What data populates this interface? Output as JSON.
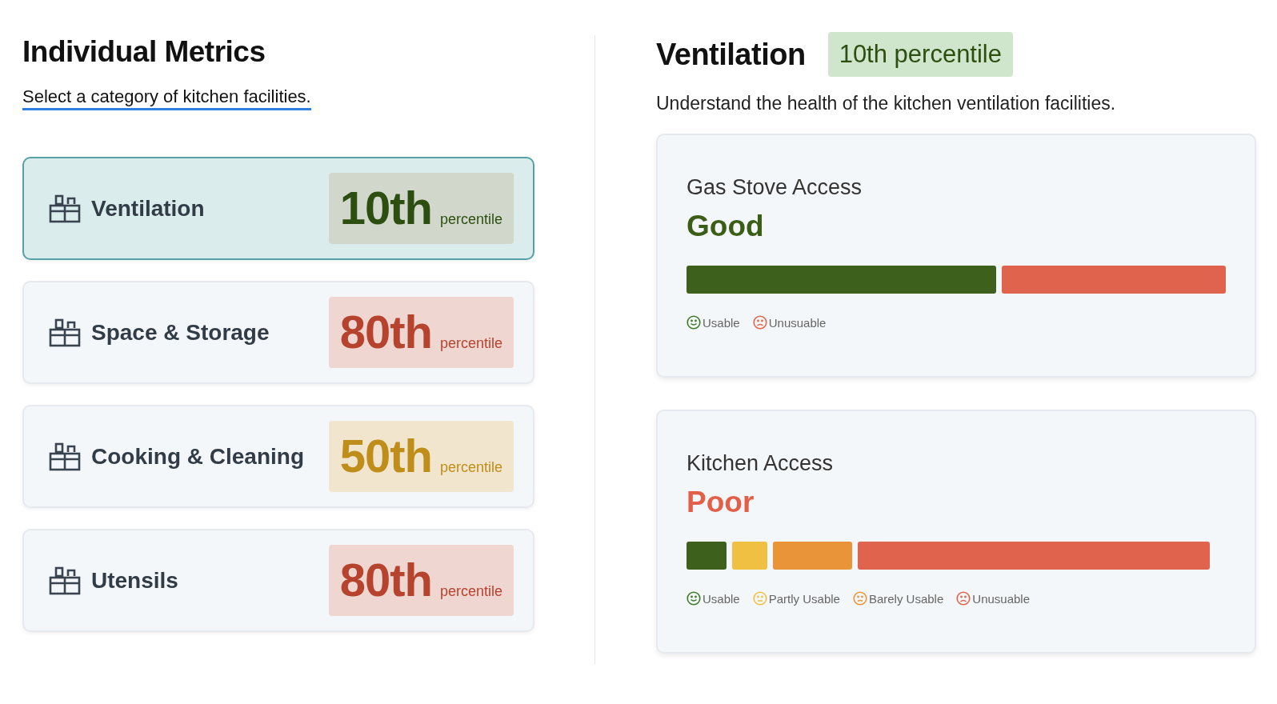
{
  "metrics_panel": {
    "title": "Individual Metrics",
    "subtitle": "Select a category of kitchen facilities.",
    "categories": [
      {
        "label": "Ventilation",
        "rank": "10th",
        "unit": "percentile",
        "color": "#2c4f11",
        "selected": true
      },
      {
        "label": "Space & Storage",
        "rank": "80th",
        "unit": "percentile",
        "color": "#b5432e",
        "selected": false
      },
      {
        "label": "Cooking & Cleaning",
        "rank": "50th",
        "unit": "percentile",
        "color": "#bf8d1a",
        "selected": false
      },
      {
        "label": "Utensils",
        "rank": "80th",
        "unit": "percentile",
        "color": "#b5432e",
        "selected": false
      }
    ]
  },
  "detail_panel": {
    "title": "Ventilation",
    "badge": "10th percentile",
    "description": "Understand the health of the kitchen ventilation facilities.",
    "cards": [
      {
        "title": "Gas Stove Access",
        "rating": "Good",
        "color": "#3b5e17",
        "segments": [
          {
            "color": "#3d611c"
          },
          {
            "color": "#e0634d"
          }
        ],
        "legend": [
          {
            "label": "Usable",
            "kind": "happy",
            "color": "#3d7a25"
          },
          {
            "label": "Unusuable",
            "kind": "sad",
            "color": "#e0634d"
          }
        ]
      },
      {
        "title": "Kitchen Access",
        "rating": "Poor",
        "color": "#e2604a",
        "segments": [
          {
            "color": "#3d611c"
          },
          {
            "color": "#f0c043"
          },
          {
            "color": "#e99438"
          },
          {
            "color": "#e0634d"
          }
        ],
        "legend": [
          {
            "label": "Usable",
            "kind": "happy",
            "color": "#3d7a25"
          },
          {
            "label": "Partly Usable",
            "kind": "neutral",
            "color": "#f0c043"
          },
          {
            "label": "Barely Usable",
            "kind": "worried",
            "color": "#e99438"
          },
          {
            "label": "Unusuable",
            "kind": "sad",
            "color": "#e0634d"
          }
        ]
      }
    ]
  }
}
